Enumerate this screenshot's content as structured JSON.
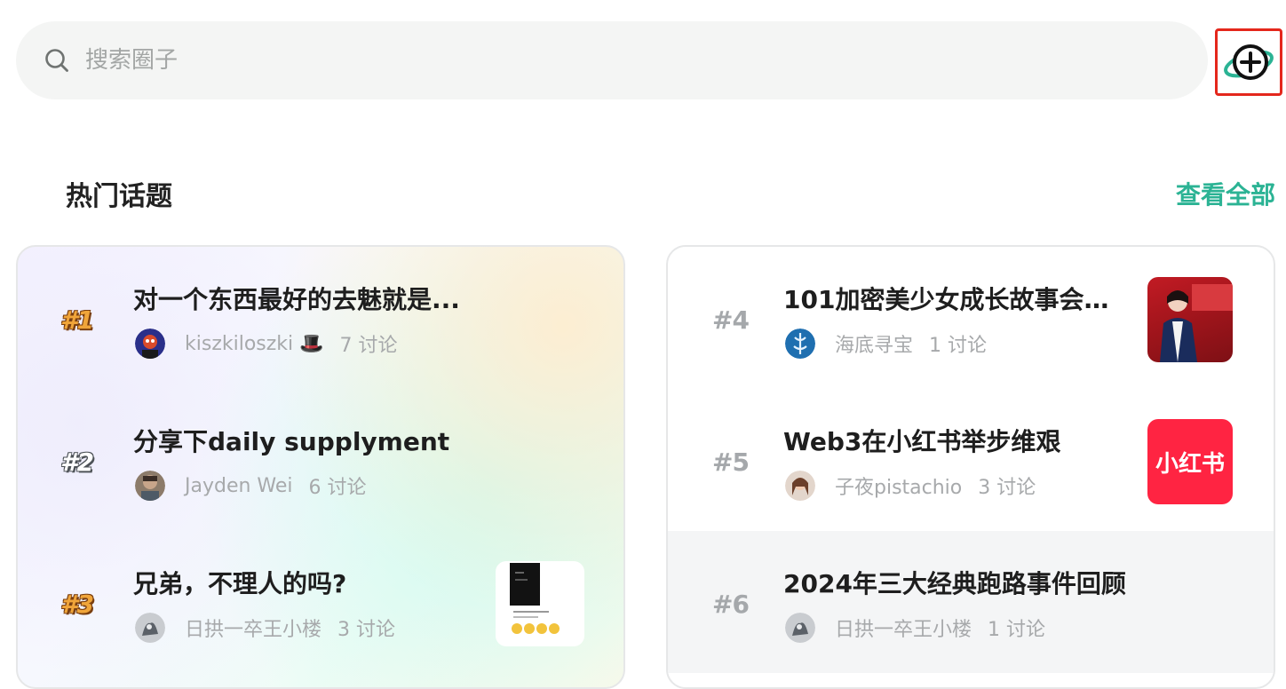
{
  "search": {
    "placeholder": "搜索圈子"
  },
  "section": {
    "title": "热门话题",
    "view_all": "查看全部"
  },
  "thumb_labels": {
    "xiaohongshu": "小红书"
  },
  "topics_left": [
    {
      "rank": "#1",
      "title": "对一个东西最好的去魅就是...",
      "author": "kiszkiloszki 🎩",
      "count": "7 讨论"
    },
    {
      "rank": "#2",
      "title": "分享下daily supplyment",
      "author": "Jayden Wei",
      "count": "6 讨论"
    },
    {
      "rank": "#3",
      "title": "兄弟，不理人的吗?",
      "author": "日拱一卒王小楼",
      "count": "3 讨论"
    }
  ],
  "topics_right": [
    {
      "rank": "#4",
      "title": "101加密美少女成长故事会（...",
      "author": "海底寻宝",
      "count": "1 讨论"
    },
    {
      "rank": "#5",
      "title": "Web3在小红书举步维艰",
      "author": "子夜pistachio",
      "count": "3 讨论"
    },
    {
      "rank": "#6",
      "title": "2024年三大经典跑路事件回顾",
      "author": "日拱一卒王小楼",
      "count": "1 讨论"
    }
  ],
  "colors": {
    "accent": "#2bb394",
    "highlight_box": "#e4271c",
    "xiaohongshu": "#ff2442"
  },
  "icons": {
    "search": "search-icon",
    "create": "create-circle-icon"
  }
}
